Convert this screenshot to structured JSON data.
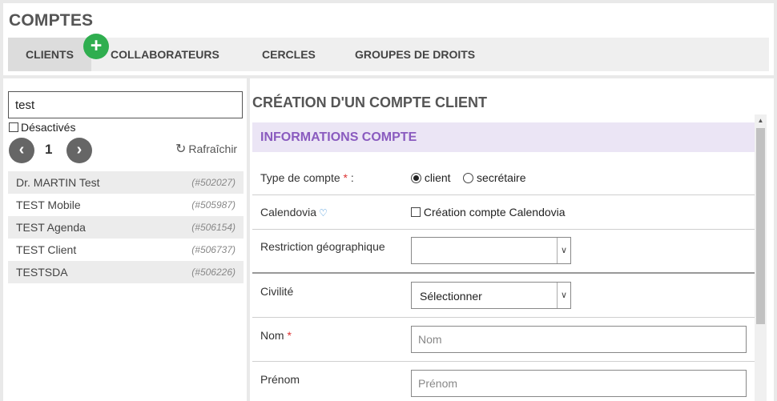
{
  "app": {
    "title": "COMPTES"
  },
  "tabs": [
    {
      "label": "CLIENTS"
    },
    {
      "label": "COLLABORATEURS"
    },
    {
      "label": "CERCLES"
    },
    {
      "label": "GROUPES DE DROITS"
    }
  ],
  "add_button": {
    "label": "+"
  },
  "search": {
    "value": "test"
  },
  "filters": {
    "deactivated_label": "Désactivés"
  },
  "pagination": {
    "prev": "‹",
    "page": "1",
    "next": "›"
  },
  "refresh": {
    "icon": "↻",
    "label": "Rafraîchir"
  },
  "clients": [
    {
      "name": "Dr. MARTIN Test",
      "id": "(#502027)"
    },
    {
      "name": "TEST Mobile",
      "id": "(#505987)"
    },
    {
      "name": "TEST Agenda",
      "id": "(#506154)"
    },
    {
      "name": "TEST Client",
      "id": "(#506737)"
    },
    {
      "name": "TESTSDA",
      "id": "(#506226)"
    }
  ],
  "form": {
    "title": "CRÉATION D'UN COMPTE CLIENT",
    "section": "INFORMATIONS COMPTE",
    "account_type": {
      "label": "Type de compte",
      "required": "*",
      "colon": " :",
      "option_client": "client",
      "option_secretary": "secrétaire"
    },
    "calendovia": {
      "label": "Calendovia",
      "icon": "♡",
      "checkbox_label": "Création compte Calendovia"
    },
    "geo": {
      "label": "Restriction géographique",
      "value": ""
    },
    "civility": {
      "label": "Civilité",
      "value": "Sélectionner"
    },
    "last_name": {
      "label": "Nom",
      "required": "*",
      "placeholder": "Nom"
    },
    "first_name": {
      "label": "Prénom",
      "placeholder": "Prénom"
    },
    "select_arrow": "∨"
  },
  "colors": {
    "accent_purple": "#8a5bbf",
    "section_bg": "#ebe5f5",
    "add_green": "#2fae4f",
    "required_red": "#d33333"
  }
}
